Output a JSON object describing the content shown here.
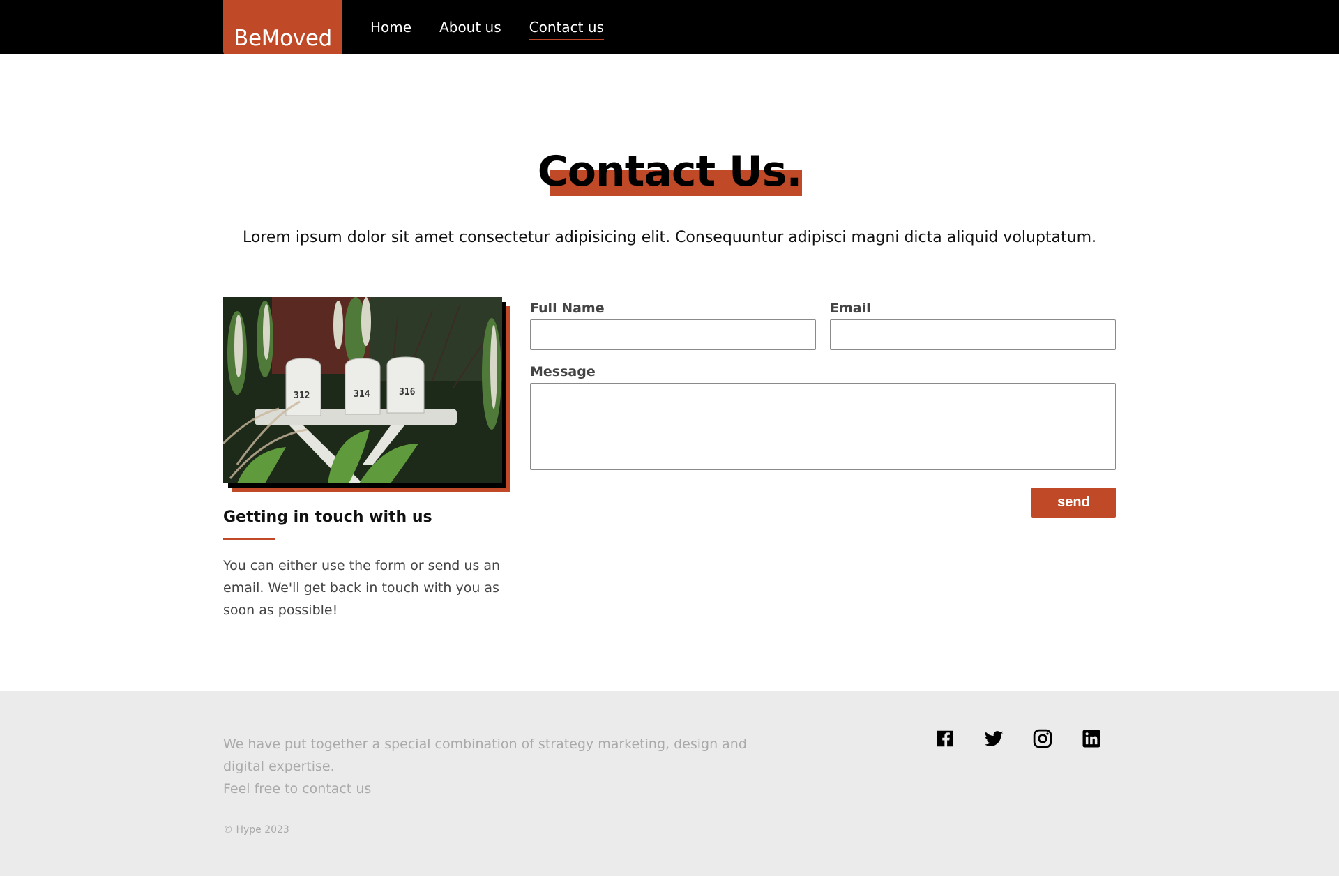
{
  "header": {
    "logo": "BeMoved",
    "nav": [
      {
        "label": "Home",
        "active": false
      },
      {
        "label": "About us",
        "active": false
      },
      {
        "label": "Contact us",
        "active": true
      }
    ]
  },
  "hero": {
    "title": "Contact Us.",
    "subtitle": "Lorem ipsum dolor sit amet consectetur adipisicing elit. Consequuntur adipisci magni dicta aliquid voluptatum."
  },
  "photo": {
    "mailbox_numbers": [
      "312",
      "314",
      "316"
    ]
  },
  "side": {
    "heading": "Getting in touch with us",
    "text": "You can either use the form or send us an email. We'll get back in touch with you as soon as possible!"
  },
  "form": {
    "full_name_label": "Full Name",
    "full_name_value": "",
    "email_label": "Email",
    "email_value": "",
    "message_label": "Message",
    "message_value": "",
    "send_label": "send"
  },
  "footer": {
    "line1": "We have put together a special combination of strategy marketing, design and digital expertise.",
    "line2": "Feel free to contact us",
    "copyright": "© Hype 2023",
    "social_icons": [
      "facebook-icon",
      "twitter-icon",
      "instagram-icon",
      "linkedin-icon"
    ]
  },
  "colors": {
    "accent": "#c04a28",
    "header_bg": "#000000",
    "footer_bg": "#ebebeb"
  }
}
